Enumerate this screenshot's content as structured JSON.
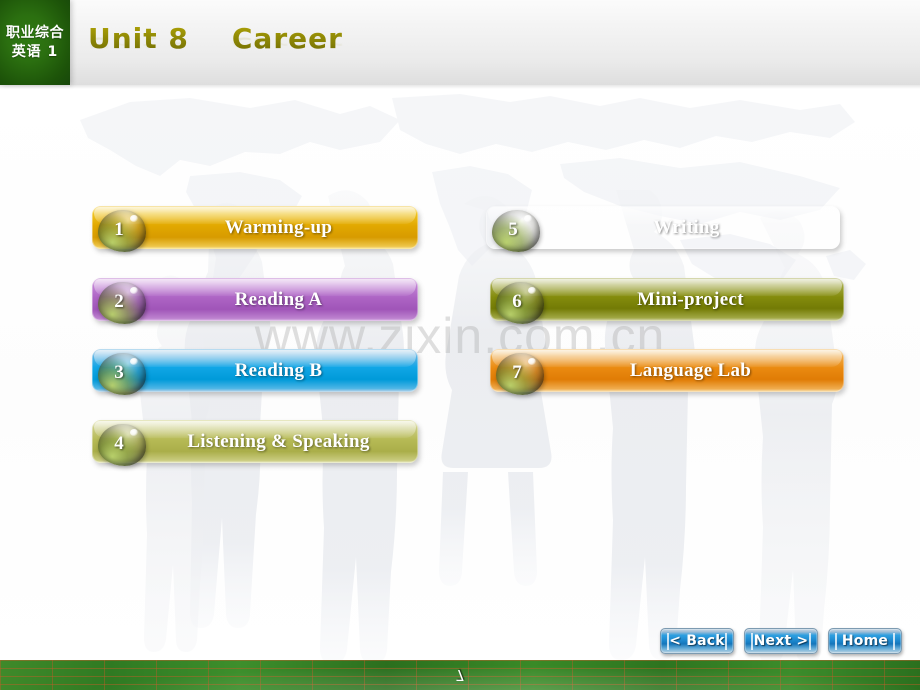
{
  "header": {
    "course_badge": {
      "line1": "职业综合",
      "line2": "英语 1"
    },
    "unit_title": "Unit 8    Career",
    "title_color": "#8a8a07",
    "badge_color": "#2b6f10"
  },
  "background": {
    "watermark": "www.zixin.com.cn",
    "map_name": "world-map",
    "silhouettes_name": "business-people-silhouettes"
  },
  "menu": {
    "left_column": [
      {
        "number": "1",
        "label": "Warming-up",
        "color": "#e0a800"
      },
      {
        "number": "2",
        "label": "Reading A",
        "color": "#b06bc4"
      },
      {
        "number": "3",
        "label": "Reading B",
        "color": "#00a3e0"
      },
      {
        "number": "4",
        "label": "Listening & Speaking",
        "color": "#b3b560"
      }
    ],
    "right_column": [
      {
        "number": "5",
        "label": "Writing",
        "color": "#a8246c"
      },
      {
        "number": "6",
        "label": "Mini-project",
        "color": "#76800a"
      },
      {
        "number": "7",
        "label": "Language Lab",
        "color": "#e88310"
      }
    ]
  },
  "nav": {
    "back_label": "< Back",
    "next_label": "Next >",
    "home_label": "Home"
  },
  "footer": {
    "page_number": "7",
    "bar_color": "#2f7a22"
  }
}
